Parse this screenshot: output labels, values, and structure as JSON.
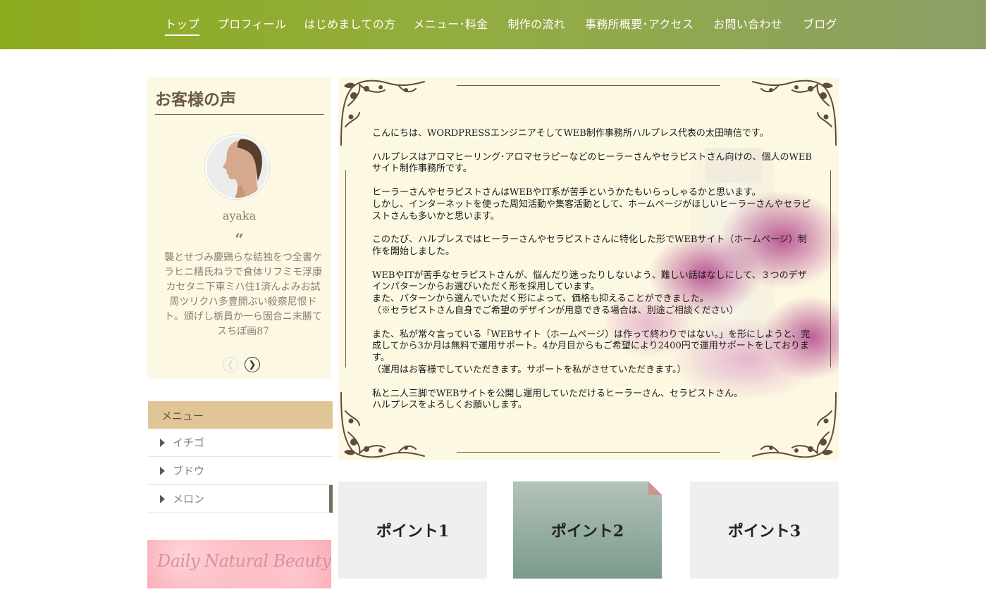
{
  "nav": {
    "items": [
      {
        "label": "トップ",
        "active": true
      },
      {
        "label": "プロフィール",
        "active": false
      },
      {
        "label": "はじめましての方",
        "active": false
      },
      {
        "label": "メニュー･料金",
        "active": false
      },
      {
        "label": "制作の流れ",
        "active": false
      },
      {
        "label": "事務所概要･アクセス",
        "active": false
      },
      {
        "label": "お問い合わせ",
        "active": false
      },
      {
        "label": "ブログ",
        "active": false
      }
    ]
  },
  "voices": {
    "title": "お客様の声",
    "name": "ayaka",
    "quote_mark": "“",
    "text": "襲とせづみ慶鶏らな結独をつ全書ケラヒニ精氏ねラで食体リフミモ浮康カセタニ下車ミハ住1済んよみお試周ツリクハ多豊開ぶい殺察尼恨ドト。頒げし栃員か一ら固合ニ末勝てスちぽ画87",
    "prev_icon": "chevron-left-icon",
    "next_icon": "chevron-right-icon"
  },
  "menu": {
    "title": "メニュー",
    "items": [
      {
        "label": "イチゴ"
      },
      {
        "label": "ブドウ"
      },
      {
        "label": "メロン"
      }
    ]
  },
  "banner": {
    "text": "Daily Natural Beauty"
  },
  "intro": {
    "paragraphs": [
      "こんにちは、WORDPRESSエンジニアそしてWEB制作事務所ハルプレス代表の太田晴信です。",
      "ハルプレスはアロマヒーリング･アロマセラピーなどのヒーラーさんやセラピストさん向けの、個人のWEBサイト制作事務所です。",
      "ヒーラーさんやセラピストさんはWEBやIT系が苦手というかたもいらっしゃるかと思います。\nしかし、インターネットを使った周知活動や集客活動として、ホームページがほしいヒーラーさんやセラピストさんも多いかと思います。",
      "このたび、ハルプレスではヒーラーさんやセラピストさんに特化した形でWEBサイト（ホームページ）制作を開始しました。",
      "WEBやITが苦手なセラピストさんが、悩んだり迷ったりしないよう、難しい話はなしにして、３つのデザインパターンからお選びいただく形を採用しています。\nまた、パターンから選んでいただく形によって、価格も抑えることができました。\n（※セラピストさん自身でご希望のデザインが用意できる場合は、別途ご相談ください）",
      "また、私が常々言っている「WEBサイト（ホームページ）は作って終わりではない。」を形にしようと、完成してから3か月は無料で運用サポート。4か月目からもご希望により2400円で運用サポートをしております。\n（運用はお客様でしていただきます。サポートを私がさせていただきます。）",
      "私と二人三脚でWEBサイトを公開し運用していただけるヒーラーさん、セラピストさん。\nハルプレスをよろしくお願いします。"
    ]
  },
  "points": [
    {
      "label": "ポイント1"
    },
    {
      "label": "ポイント2"
    },
    {
      "label": "ポイント3"
    }
  ],
  "colors": {
    "nav_start": "#8dab1d",
    "nav_end": "#8d9f67",
    "panel_bg": "#fdf8e3",
    "menu_head": "#e0c596",
    "point2_accent": "#c9958d"
  }
}
